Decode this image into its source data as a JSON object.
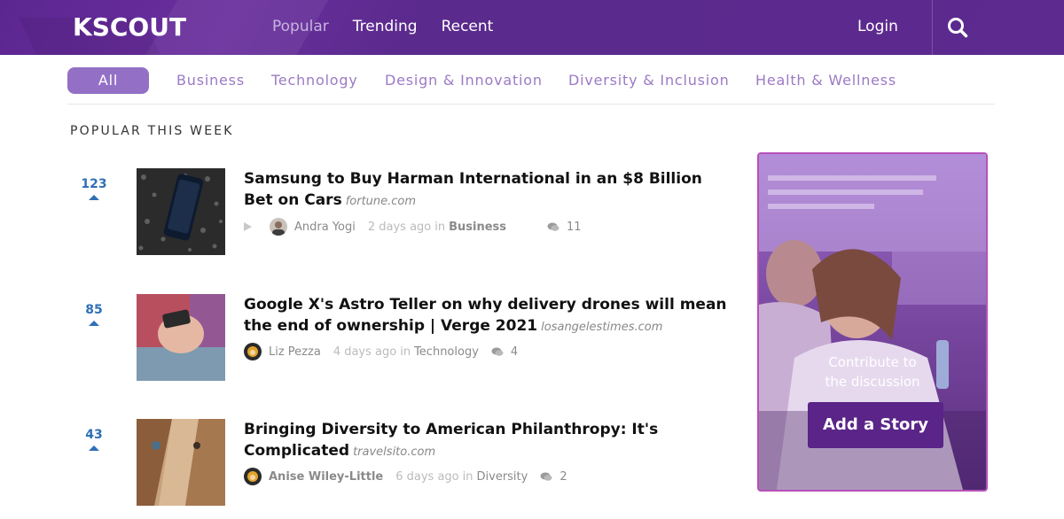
{
  "header": {
    "logo": "KSCOUT",
    "nav": [
      {
        "label": "Popular",
        "active": true
      },
      {
        "label": "Trending",
        "active": false
      },
      {
        "label": "Recent",
        "active": false
      }
    ],
    "login_label": "Login",
    "search_icon": "search-icon"
  },
  "categories": [
    {
      "label": "All",
      "active": true
    },
    {
      "label": "Business"
    },
    {
      "label": "Technology"
    },
    {
      "label": "Design & Innovation"
    },
    {
      "label": "Diversity & Inclusion"
    },
    {
      "label": "Health & Wellness"
    }
  ],
  "section_title": "POPULAR THIS WEEK",
  "stories": [
    {
      "votes": "123",
      "title": "Samsung to Buy Harman International in an $8 Billion Bet on Cars",
      "domain": "fortune.com",
      "author": "Andra Yogi",
      "time": "2 days ago",
      "in_label": "in",
      "category": "Business",
      "comments": "11",
      "has_play": true
    },
    {
      "votes": "85",
      "title": "Google X's Astro Teller on why delivery drones will mean the end of ownership | Verge 2021",
      "domain": "losangelestimes.com",
      "author": "Liz Pezza",
      "time": "4 days ago",
      "in_label": "in",
      "category": "Technology",
      "comments": "4",
      "has_play": false
    },
    {
      "votes": "43",
      "title": "Bringing Diversity to American Philanthropy: It's Complicated",
      "domain": "travelsito.com",
      "author": "Anise Wiley-Little",
      "time": "6 days ago",
      "in_label": "in",
      "category": "Diversity",
      "comments": "2",
      "has_play": false
    }
  ],
  "promo": {
    "line1": "Contribute to",
    "line2": "the discussion",
    "button": "Add a Story"
  },
  "colors": {
    "header_bg": "#5c2690",
    "accent": "#9370c6",
    "vote_blue": "#2f6fb6",
    "cta_bg": "#5a2488",
    "promo_border": "#b84fb9"
  }
}
